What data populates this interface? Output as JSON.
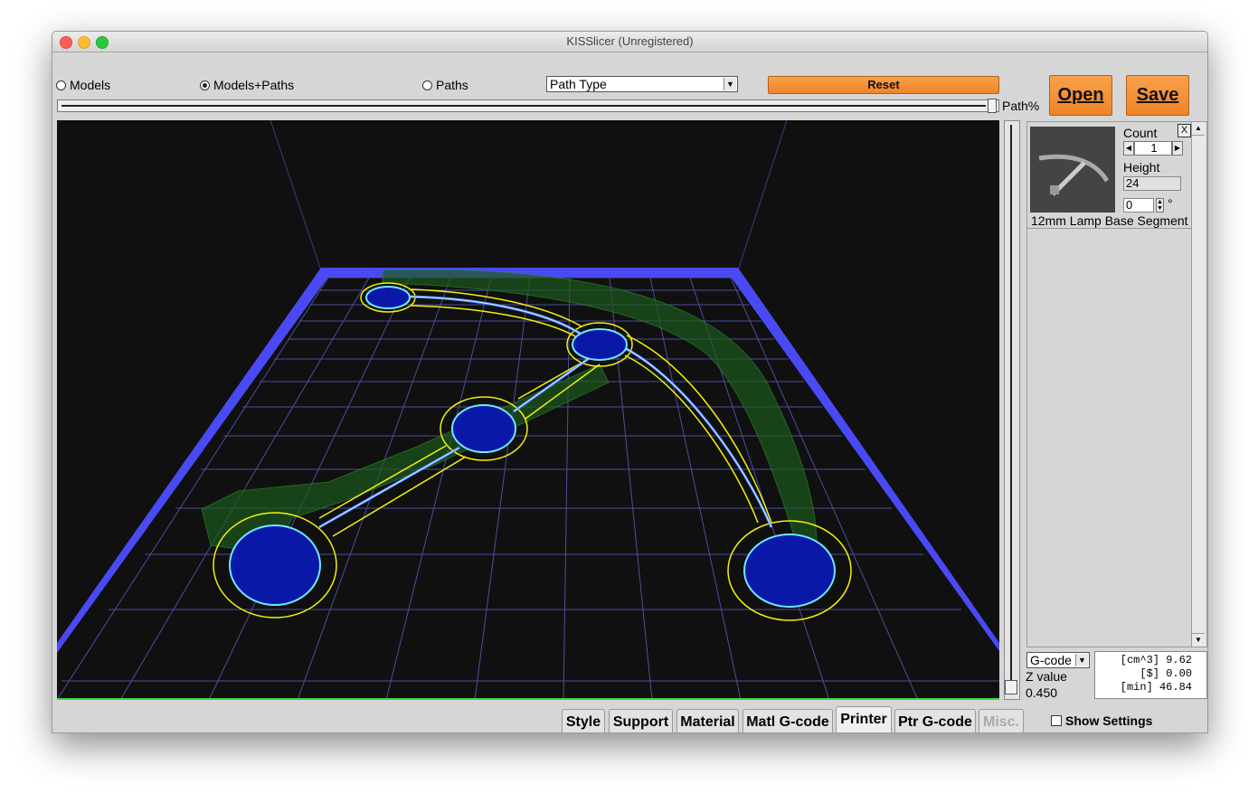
{
  "window": {
    "title": "KISSlicer (Unregistered)"
  },
  "view_modes": [
    {
      "label": "Models",
      "selected": false
    },
    {
      "label": "Models+Paths",
      "selected": true
    },
    {
      "label": "Paths",
      "selected": false
    }
  ],
  "path_type": {
    "selected": "Path Type"
  },
  "buttons": {
    "reset": "Reset",
    "open": "Open",
    "save": "Save"
  },
  "path_slider": {
    "label": "Path%",
    "value_fraction": 1.0
  },
  "model_card": {
    "count_label": "Count",
    "count_value": "1",
    "height_label": "Height",
    "height_value": "24",
    "rotation_value": "0",
    "rotation_unit": "°",
    "close_label": "X",
    "name": "12mm Lamp Base Segment"
  },
  "output": {
    "format_selected": "G-code",
    "z_label": "Z value",
    "z_value": "0.450",
    "stats": [
      {
        "unit": "[cm^3]",
        "value": "9.62"
      },
      {
        "unit": "[$]",
        "value": "0.00"
      },
      {
        "unit": "[min]",
        "value": "46.84"
      }
    ]
  },
  "tabs": [
    "Style",
    "Support",
    "Material",
    "Matl G-code",
    "Printer",
    "Ptr G-code",
    "Misc."
  ],
  "show_settings": {
    "label": "Show Settings",
    "checked": false
  },
  "colors": {
    "accent_orange": "#f39339",
    "bed_blue": "#4a4af5",
    "path_yellow": "#f2f20a",
    "grid": "#4d4d9e"
  }
}
